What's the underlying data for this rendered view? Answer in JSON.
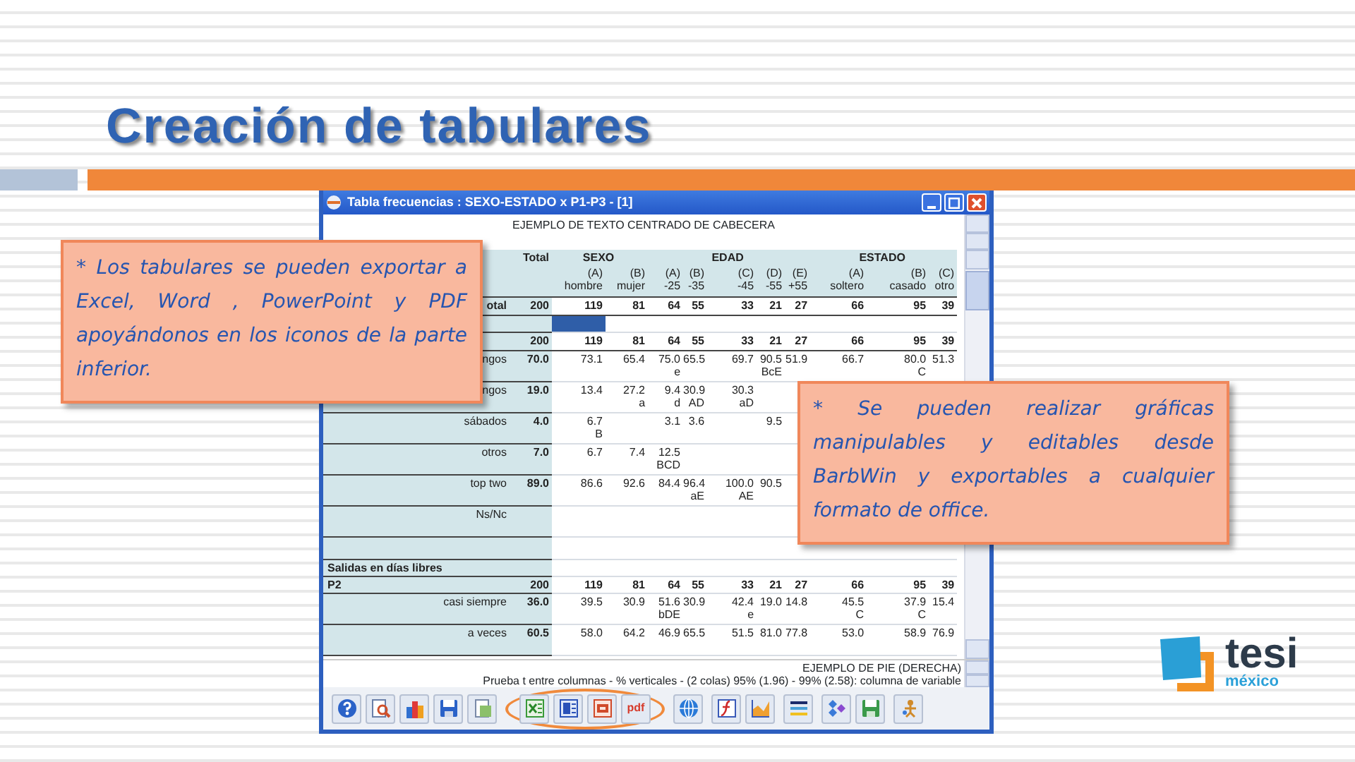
{
  "slide": {
    "title": "Creación de tabulares"
  },
  "window": {
    "title": "Tabla frecuencias : SEXO-ESTADO x P1-P3  - [1]",
    "header_text": "EJEMPLO DE TEXTO CENTRADO DE CABECERA",
    "footer_title": "EJEMPLO DE PIE (DERECHA)",
    "footer_note": "Prueba t entre columnas - % verticales - (2 colas) 95% (1.96) - 99% (2.58): columna de variable"
  },
  "table": {
    "total_heading": "Total",
    "groups": [
      {
        "label": "SEXO",
        "columns": [
          {
            "letter": "(A)",
            "name": "hombre"
          },
          {
            "letter": "(B)",
            "name": "mujer"
          }
        ]
      },
      {
        "label": "EDAD",
        "columns": [
          {
            "letter": "(A)",
            "name": "-25"
          },
          {
            "letter": "(B)",
            "name": "-35"
          },
          {
            "letter": "(C)",
            "name": "-45"
          },
          {
            "letter": "(D)",
            "name": "-55"
          },
          {
            "letter": "(E)",
            "name": "+55"
          }
        ]
      },
      {
        "label": "ESTADO",
        "columns": [
          {
            "letter": "(A)",
            "name": "soltero"
          },
          {
            "letter": "(B)",
            "name": "casado"
          },
          {
            "letter": "(C)",
            "name": "otro"
          }
        ]
      }
    ],
    "rows": [
      {
        "kind": "total",
        "label": "otal",
        "value": "200",
        "cells": [
          {
            "value": "119"
          },
          {
            "value": "81"
          },
          {
            "value": "64"
          },
          {
            "value": "55"
          },
          {
            "value": "33"
          },
          {
            "value": "21"
          },
          {
            "value": "27"
          },
          {
            "value": "66"
          },
          {
            "value": "95"
          },
          {
            "value": "39"
          }
        ]
      },
      {
        "kind": "selection",
        "cells": [
          {
            "selected": true
          },
          {
            "selected": false
          },
          {
            "selected": false
          },
          {
            "selected": false
          },
          {
            "selected": false
          },
          {
            "selected": false
          },
          {
            "selected": false
          },
          {
            "selected": false
          },
          {
            "selected": false
          },
          {
            "selected": false
          }
        ]
      },
      {
        "kind": "total",
        "value": "200",
        "cells": [
          {
            "value": "119"
          },
          {
            "value": "81"
          },
          {
            "value": "64"
          },
          {
            "value": "55"
          },
          {
            "value": "33"
          },
          {
            "value": "21"
          },
          {
            "value": "27"
          },
          {
            "value": "66"
          },
          {
            "value": "95"
          },
          {
            "value": "39"
          }
        ]
      },
      {
        "kind": "data",
        "label": "ngos",
        "value": "70.0",
        "cells": [
          {
            "value": "73.1"
          },
          {
            "value": "65.4"
          },
          {
            "value": "75.0",
            "sig": "e"
          },
          {
            "value": "65.5"
          },
          {
            "value": "69.7"
          },
          {
            "value": "90.5",
            "sig": "BcE"
          },
          {
            "value": "51.9"
          },
          {
            "value": "66.7"
          },
          {
            "value": "80.0",
            "sig": "C"
          },
          {
            "value": "51.3"
          }
        ]
      },
      {
        "kind": "data",
        "label": "ngos",
        "value": "19.0",
        "cells": [
          {
            "value": "13.4"
          },
          {
            "value": "27.2",
            "sig": "a"
          },
          {
            "value": "9.4",
            "sig": "d"
          },
          {
            "value": "30.9",
            "sig": "AD"
          },
          {
            "value": "30.3",
            "sig": "aD"
          },
          null,
          null,
          null,
          null,
          null
        ]
      },
      {
        "kind": "data",
        "label": "sábados",
        "value": "4.0",
        "cells": [
          {
            "value": "6.7",
            "sig": "B"
          },
          null,
          {
            "value": "3.1"
          },
          {
            "value": "3.6"
          },
          null,
          {
            "value": "9.5"
          },
          null,
          null,
          null,
          null
        ]
      },
      {
        "kind": "data",
        "label": "otros",
        "value": "7.0",
        "cells": [
          {
            "value": "6.7"
          },
          {
            "value": "7.4"
          },
          {
            "value": "12.5",
            "sig": "BCD"
          },
          null,
          null,
          null,
          null,
          null,
          null,
          null
        ]
      },
      {
        "kind": "data",
        "label": "top two",
        "value": "89.0",
        "cells": [
          {
            "value": "86.6"
          },
          {
            "value": "92.6"
          },
          {
            "value": "84.4"
          },
          {
            "value": "96.4",
            "sig": "aE"
          },
          {
            "value": "100.0",
            "sig": "AE"
          },
          {
            "value": "90.5"
          },
          null,
          null,
          null,
          null
        ]
      },
      {
        "kind": "data",
        "label": "Ns/Nc",
        "cells": [
          null,
          null,
          null,
          null,
          null,
          null,
          null,
          null,
          null,
          null
        ]
      },
      {
        "kind": "blank"
      },
      {
        "kind": "section",
        "label": "Salidas en días libres"
      },
      {
        "kind": "variable",
        "label": "P2",
        "value": "200",
        "cells": [
          {
            "value": "119"
          },
          {
            "value": "81"
          },
          {
            "value": "64"
          },
          {
            "value": "55"
          },
          {
            "value": "33"
          },
          {
            "value": "21"
          },
          {
            "value": "27"
          },
          {
            "value": "66"
          },
          {
            "value": "95"
          },
          {
            "value": "39"
          }
        ]
      },
      {
        "kind": "data",
        "label": "casi siempre",
        "value": "36.0",
        "cells": [
          {
            "value": "39.5"
          },
          {
            "value": "30.9"
          },
          {
            "value": "51.6",
            "sig": "bDE"
          },
          {
            "value": "30.9"
          },
          {
            "value": "42.4",
            "sig": "e"
          },
          {
            "value": "19.0"
          },
          {
            "value": "14.8"
          },
          {
            "value": "45.5",
            "sig": "C"
          },
          {
            "value": "37.9",
            "sig": "C"
          },
          {
            "value": "15.4"
          }
        ]
      },
      {
        "kind": "data",
        "label": "a veces",
        "value": "60.5",
        "cells": [
          {
            "value": "58.0"
          },
          {
            "value": "64.2"
          },
          {
            "value": "46.9"
          },
          {
            "value": "65.5"
          },
          {
            "value": "51.5"
          },
          {
            "value": "81.0"
          },
          {
            "value": "77.8"
          },
          {
            "value": "53.0"
          },
          {
            "value": "58.9"
          },
          {
            "value": "76.9"
          }
        ]
      }
    ]
  },
  "toolbar": [
    {
      "kind": "plain",
      "buttons": [
        {
          "kind": "help"
        },
        {
          "kind": "preview"
        },
        {
          "kind": "chart"
        },
        {
          "kind": "save"
        },
        {
          "kind": "copy"
        }
      ]
    },
    {
      "kind": "circled",
      "buttons": [
        {
          "kind": "excel"
        },
        {
          "kind": "word"
        },
        {
          "kind": "powerpoint"
        },
        {
          "kind": "pdf",
          "label": "pdf"
        }
      ]
    },
    {
      "kind": "plain",
      "buttons": [
        {
          "kind": "globe"
        }
      ]
    },
    {
      "kind": "plain",
      "buttons": [
        {
          "kind": "function"
        },
        {
          "kind": "area"
        }
      ]
    },
    {
      "kind": "plain",
      "buttons": [
        {
          "kind": "lines"
        }
      ]
    },
    {
      "kind": "plain",
      "buttons": [
        {
          "kind": "network"
        },
        {
          "kind": "save-green"
        }
      ]
    },
    {
      "kind": "plain",
      "buttons": [
        {
          "kind": "tools"
        }
      ]
    }
  ],
  "callouts": [
    {
      "kind": "left",
      "text": "* Los tabulares se pueden exportar a Excel, Word , PowerPoint y PDF apoyándonos en los iconos de la parte inferior."
    },
    {
      "kind": "right",
      "text": "* Se pueden realizar gráficas manipulables y editables desde BarbWin y exportables a cualquier formato de office."
    }
  ],
  "logo": {
    "name": "tesi",
    "subtitle": "méxico"
  }
}
